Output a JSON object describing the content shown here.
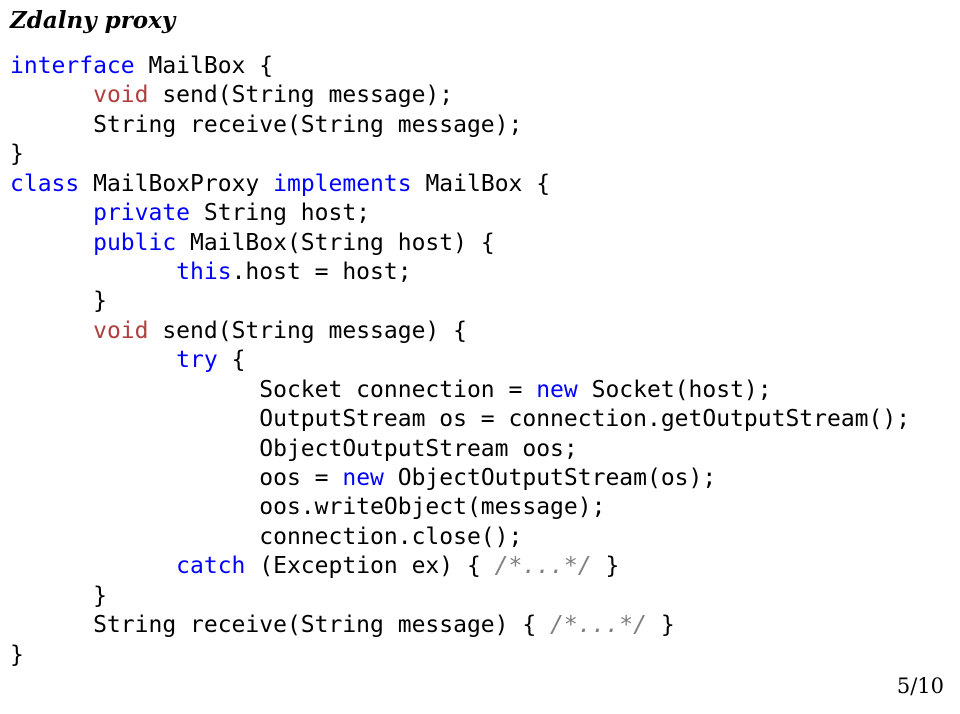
{
  "title": "Zdalny proxy",
  "code": {
    "l1_kw": "interface",
    "l1_rest": " MailBox {",
    "l2_indent": "      ",
    "l2_kw": "void",
    "l2_rest": " send(String message);",
    "l3": "      String receive(String message);",
    "l4": "}",
    "l5_kw": "class",
    "l5_mid": " MailBoxProxy ",
    "l5_kw2": "implements",
    "l5_rest": " MailBox {",
    "l6_indent": "      ",
    "l6_kw": "private",
    "l6_rest": " String host;",
    "l7_indent": "      ",
    "l7_kw": "public",
    "l7_rest": " MailBox(String host) {",
    "l8_indent": "            ",
    "l8_kw": "this",
    "l8_rest": ".host = host;",
    "l9": "      }",
    "l10_indent": "      ",
    "l10_kw": "void",
    "l10_rest": " send(String message) {",
    "l11_indent": "            ",
    "l11_kw": "try",
    "l11_rest": " {",
    "l12_indent": "                  Socket connection = ",
    "l12_kw": "new",
    "l12_rest": " Socket(host);",
    "l13": "                  OutputStream os = connection.getOutputStream();",
    "l14": "                  ObjectOutputStream oos;",
    "l15_indent": "                  oos = ",
    "l15_kw": "new",
    "l15_rest": " ObjectOutputStream(os);",
    "l16": "                  oos.writeObject(message);",
    "l17": "                  connection.close();",
    "l18_indent": "            ",
    "l18_kw": "catch",
    "l18_mid": " (Exception ex) { ",
    "l18_cm": "/*...*/",
    "l18_rest": " }",
    "l19": "      }",
    "l20_pre": "      String receive(String message) { ",
    "l20_cm": "/*...*/",
    "l20_rest": " }",
    "l21": "}"
  },
  "footer": "5/10"
}
